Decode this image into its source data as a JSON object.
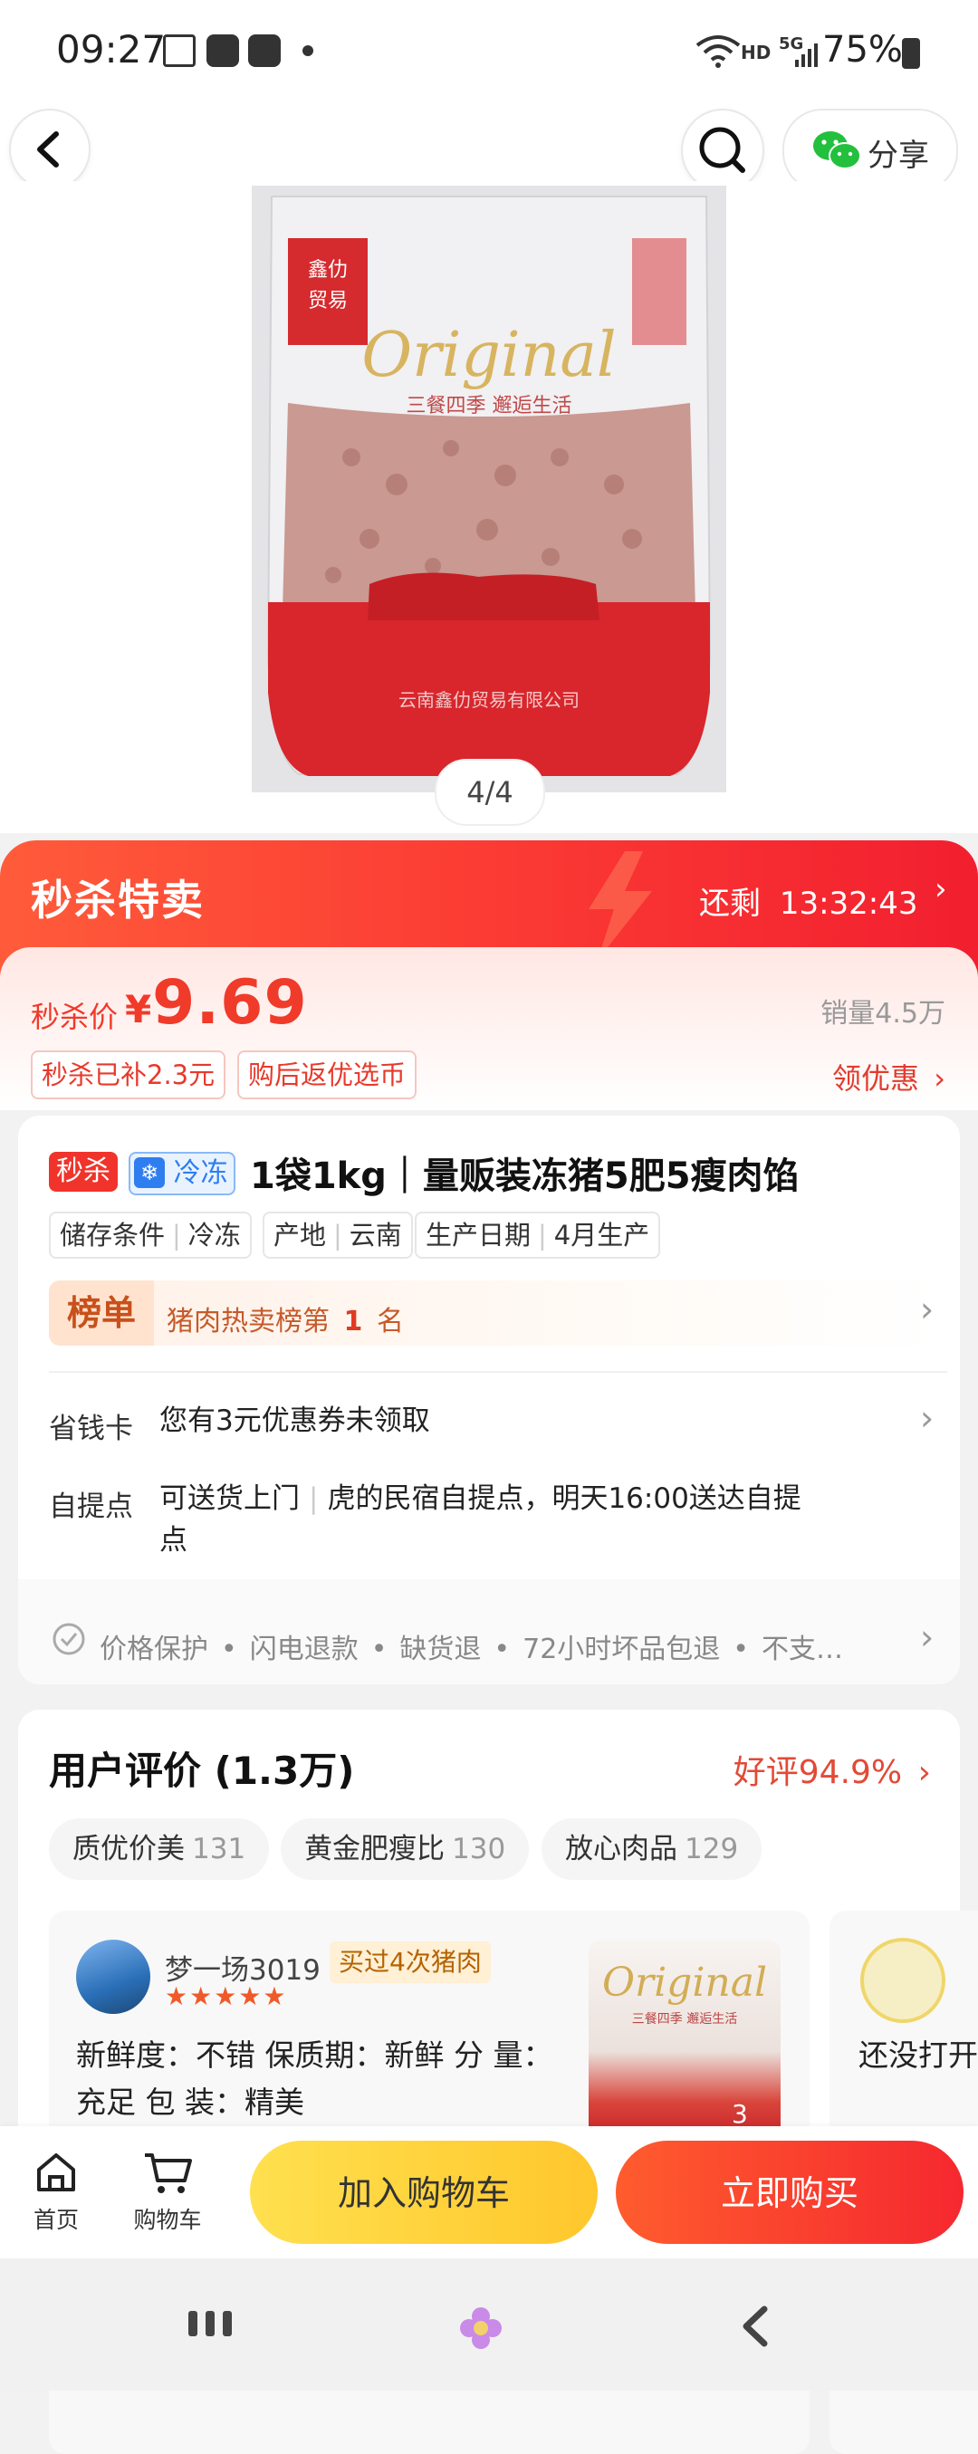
{
  "status_bar": {
    "time": "09:27",
    "network": "HD",
    "network_gen": "5G",
    "battery": "75%"
  },
  "topbar": {
    "share_label": "分享",
    "icons": [
      "back-icon",
      "search-icon",
      "wechat-icon"
    ]
  },
  "gallery": {
    "page_indicator": "4/4",
    "package_texts": {
      "brand": "鑫仂贸易",
      "script": "Original",
      "slogan": "三餐四季  邂逅生活"
    }
  },
  "flash_sale": {
    "title": "秒杀特卖",
    "countdown_label": "还剩",
    "countdown": "13:32:43"
  },
  "price": {
    "label": "秒杀价",
    "currency": "¥",
    "value": "9.69",
    "sales": "销量4.5万",
    "tags": [
      "秒杀已补2.3元",
      "购后返优选币"
    ],
    "coupon_link": "领优惠"
  },
  "product": {
    "badge_sale": "秒杀",
    "badge_frozen": "冷冻",
    "title": "1袋1kg｜量贩装冻猪5肥5瘦肉馅",
    "specs": [
      {
        "key": "储存条件",
        "value": "冷冻"
      },
      {
        "key": "产地",
        "value": "云南"
      },
      {
        "key": "生产日期",
        "value": "4月生产"
      }
    ],
    "rank_label": "榜单",
    "rank_text_pre": "猪肉热卖榜第",
    "rank_num": "1",
    "rank_text_post": "名"
  },
  "service_rows": {
    "savings_label": "省钱卡",
    "savings_text": "您有3元优惠券未领取",
    "pickup_label": "自提点",
    "pickup_delivery": "可送货上门",
    "pickup_text": "虎的民宿自提点，明天16:00送达自提点"
  },
  "guarantees": {
    "items": [
      "价格保护",
      "闪电退款",
      "缺货退",
      "72小时坏品包退",
      "不支…"
    ]
  },
  "reviews": {
    "title": "用户评价 (1.3万)",
    "good_rate": "好评94.9%",
    "pills": [
      {
        "label": "质优价美",
        "count": "131"
      },
      {
        "label": "黄金肥瘦比",
        "count": "130"
      },
      {
        "label": "放心肉品",
        "count": "129"
      }
    ],
    "first": {
      "username": "梦一场3019",
      "buy_tag": "买过4次猪肉",
      "stars": "★★★★★",
      "text": "新鲜度：不错 保质期：新鲜 分 量：充足 包 装：精美",
      "image_count": "3"
    },
    "second": {
      "text": "还没打开道好不好"
    }
  },
  "bottom_bar": {
    "home_label": "首页",
    "cart_label": "购物车",
    "add_to_cart": "加入购物车",
    "buy_now": "立即购买"
  }
}
